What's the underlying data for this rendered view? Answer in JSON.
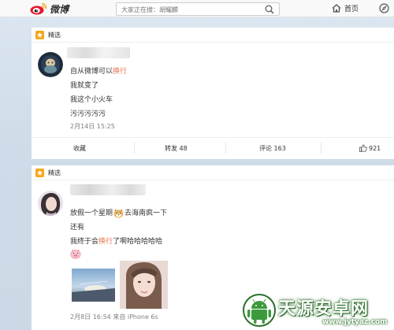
{
  "header": {
    "logo_text": "微博",
    "search_placeholder": "大家正在搜：胡耀麟",
    "home_label": "首页"
  },
  "posts": [
    {
      "badge": "精选",
      "lines": [
        {
          "pre": "自从微博可以",
          "hl": "换行",
          "post": ""
        },
        {
          "pre": "我就变了",
          "hl": "",
          "post": ""
        },
        {
          "pre": "我这个小火车",
          "hl": "",
          "post": ""
        },
        {
          "pre": "污污污污污",
          "hl": "",
          "post": ""
        }
      ],
      "time": "2月14日 15:25",
      "actions": {
        "favorite": "收藏",
        "repost": "转发 48",
        "comment": "评论 163",
        "like": "921"
      }
    },
    {
      "badge": "精选",
      "line1_pre": "放假一个星期",
      "line1_post": "去海南疯一下",
      "line2": "还有",
      "line3_pre": "我终于会",
      "line3_hl": "换行",
      "line3_post": "了啊哈哈哈哈哈",
      "time": "2月8日 16:54 来自 iPhone 6s"
    }
  ],
  "watermark": {
    "title": "天源安卓网",
    "url": "www.jytyaz.com"
  },
  "colors": {
    "highlight": "#eb7350",
    "logo_red": "#e6162d",
    "badge_orange": "#f7a51c"
  }
}
